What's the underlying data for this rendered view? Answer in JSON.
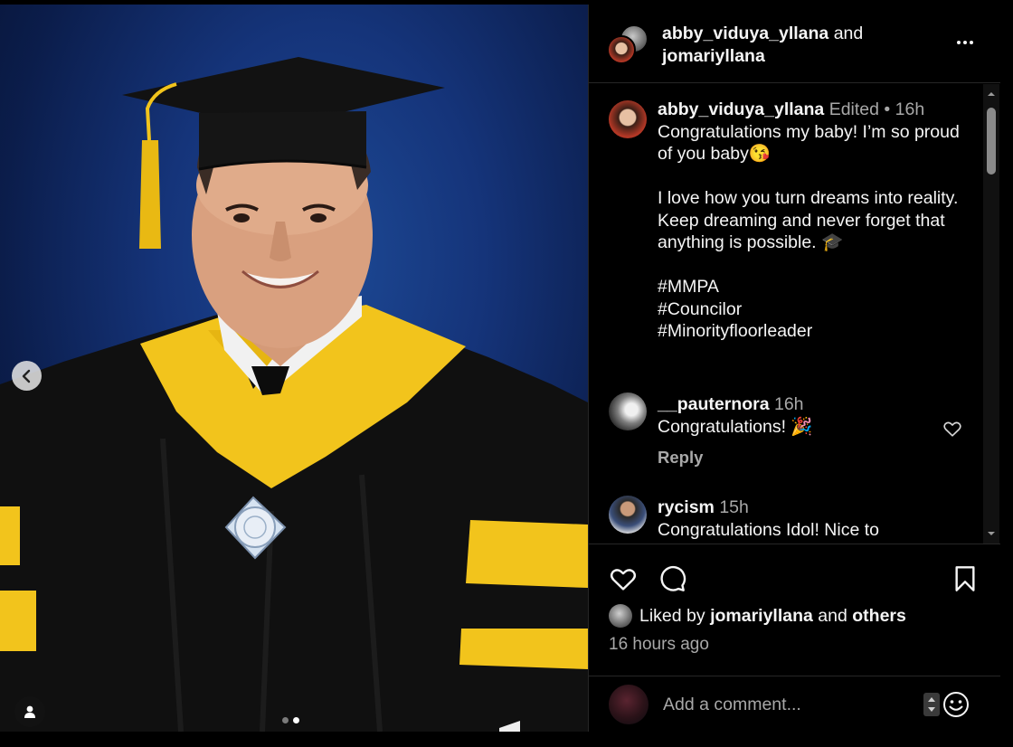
{
  "header": {
    "user1": "abby_viduya_yllana",
    "joiner": "and",
    "user2": "jomariyllana"
  },
  "icons": {
    "prev": "chevron-left-icon",
    "more": "more-options-icon",
    "like": "heart-icon",
    "comment": "comment-bubble-icon",
    "save": "bookmark-icon",
    "tag": "user-tag-icon",
    "emoji": "smiley-icon"
  },
  "carousel": {
    "total": 2,
    "active": 2
  },
  "caption": {
    "user": "abby_viduya_yllana",
    "edited": "Edited",
    "sep": "•",
    "time": "16h",
    "line1": "Congratulations my baby! I’m so proud of you baby😘",
    "line2": "I love how you turn dreams into reality.",
    "line3": "Keep dreaming and never forget that anything is possible. 🎓",
    "tag1": "#MMPA",
    "tag2": "#Councilor",
    "tag3": "#Minorityfloorleader"
  },
  "comments": [
    {
      "user": "__pauternora",
      "time": "16h",
      "text": "Congratulations! 🎉",
      "reply": "Reply"
    },
    {
      "user": "rycism",
      "time": "15h",
      "text": "Congratulations Idol! Nice to"
    }
  ],
  "likes": {
    "prefix": "Liked by",
    "user": "jomariyllana",
    "joiner": "and",
    "others": "others"
  },
  "timeago": "16 hours ago",
  "add_comment": {
    "placeholder": "Add a comment..."
  },
  "colors": {
    "background": "#000000",
    "text": "#f5f5f5",
    "muted": "#a8a8a8",
    "gown_gold": "#f2c41c",
    "backdrop_blue": "#15347a"
  }
}
